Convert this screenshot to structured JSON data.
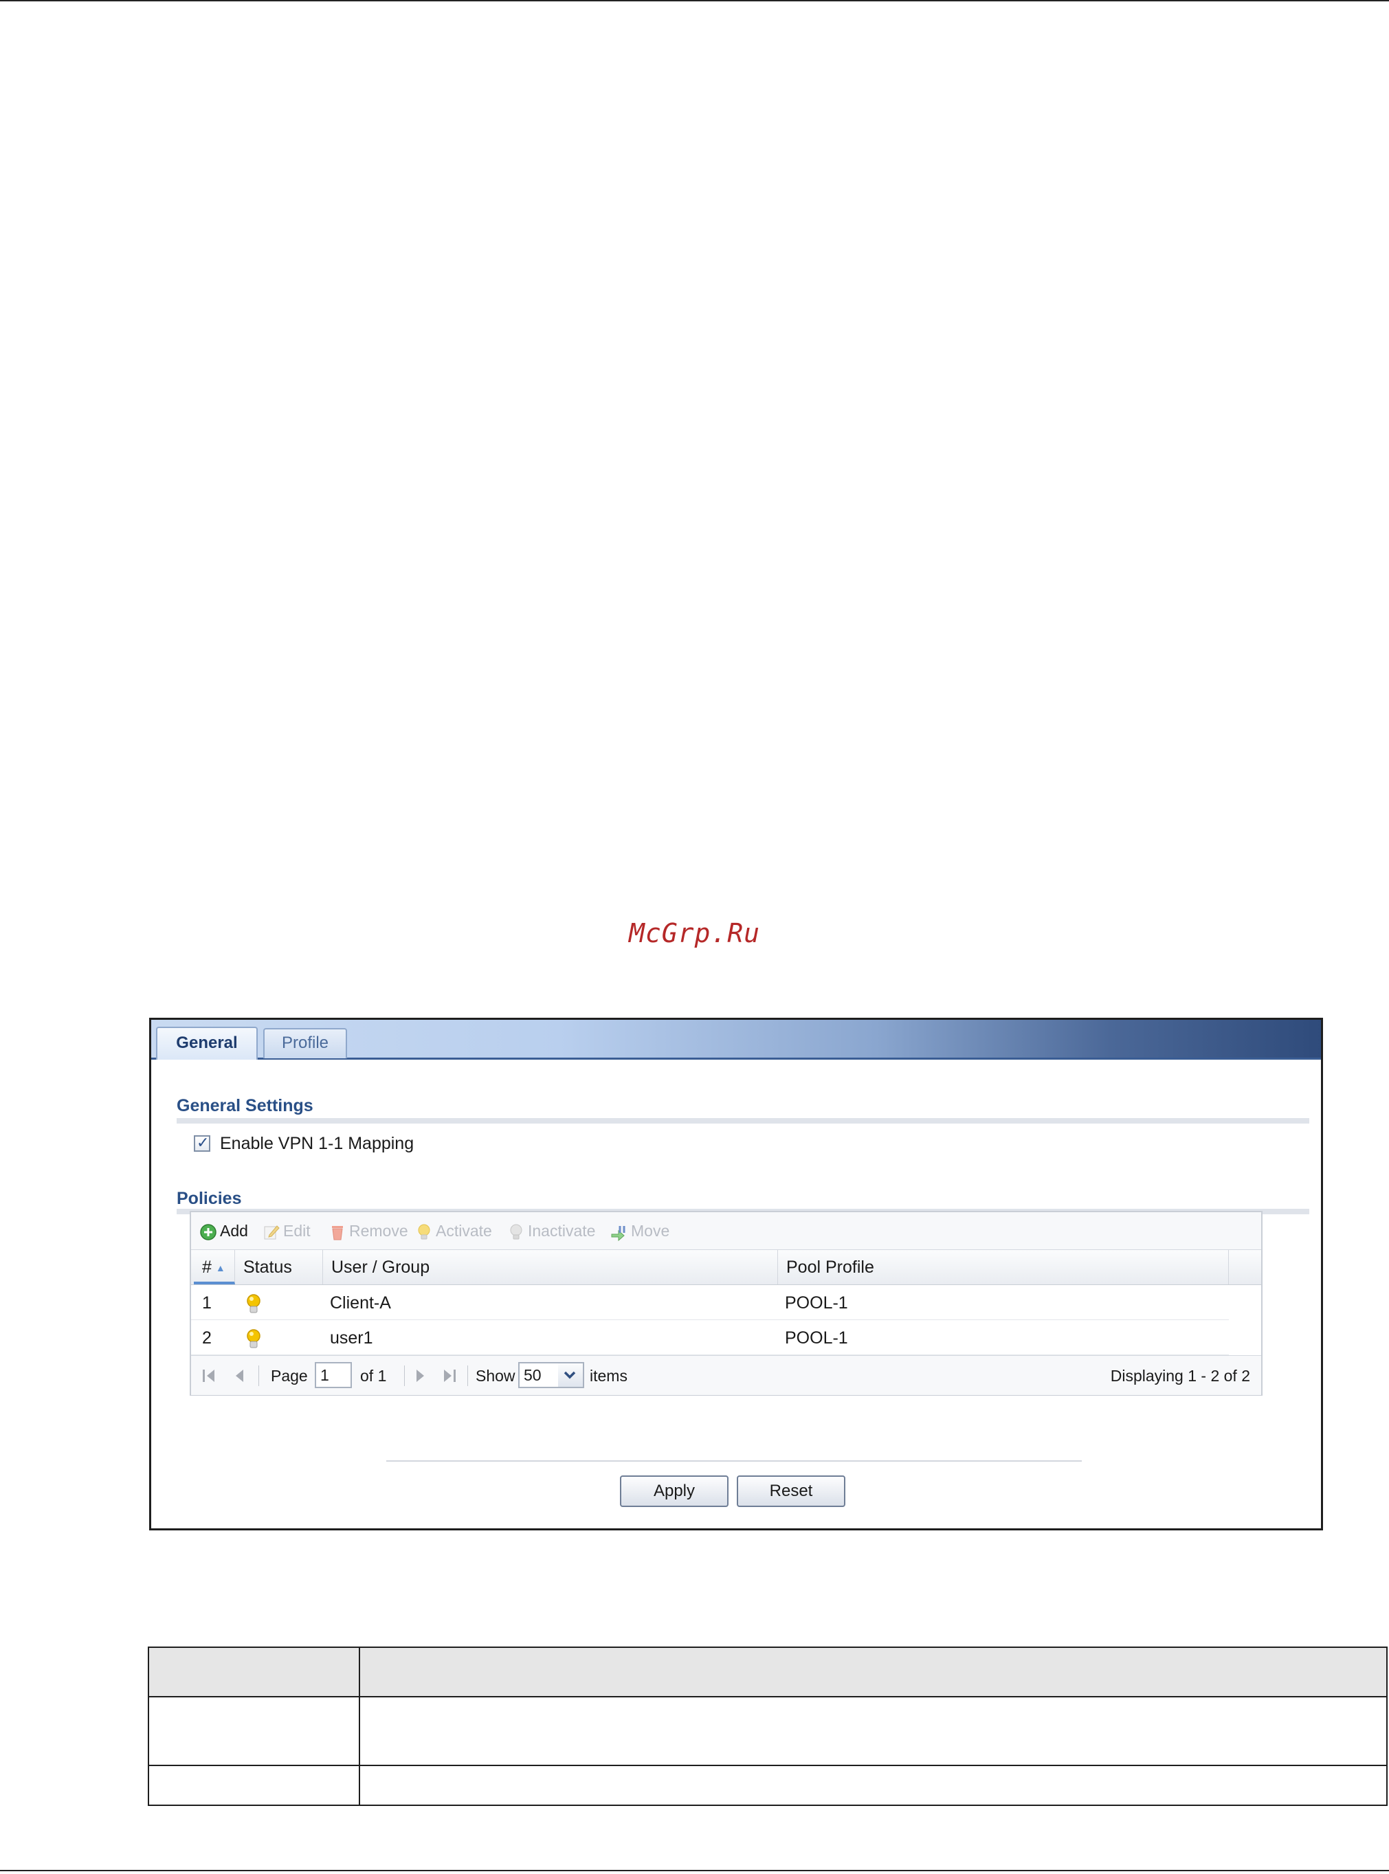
{
  "watermark": "McGrp.Ru",
  "tabs": [
    {
      "label": "General",
      "active": true
    },
    {
      "label": "Profile",
      "active": false
    }
  ],
  "general_settings": {
    "title": "General Settings",
    "enable_checkbox": {
      "label": "Enable VPN 1-1 Mapping",
      "checked": true
    }
  },
  "policies": {
    "title": "Policies",
    "toolbar": {
      "add": "Add",
      "edit": "Edit",
      "remove": "Remove",
      "activate": "Activate",
      "inactivate": "Inactivate",
      "move": "Move"
    },
    "columns": [
      "#",
      "Status",
      "User / Group",
      "Pool Profile"
    ],
    "rows": [
      {
        "num": "1",
        "status_icon": "lightbulb-on-icon",
        "user_group": "Client-A",
        "pool_profile": "POOL-1"
      },
      {
        "num": "2",
        "status_icon": "lightbulb-on-icon",
        "user_group": "user1",
        "pool_profile": "POOL-1"
      }
    ],
    "pager": {
      "page_label": "Page",
      "page_value": "1",
      "of_label": "of 1",
      "show_label": "Show",
      "show_value": "50",
      "items_label": "items",
      "displaying": "Displaying 1 - 2 of 2"
    }
  },
  "buttons": {
    "apply": "Apply",
    "reset": "Reset"
  },
  "colors": {
    "accent": "#294f86",
    "tab_gradient_end": "#2f4b7b",
    "bulb": "#f2c200"
  }
}
